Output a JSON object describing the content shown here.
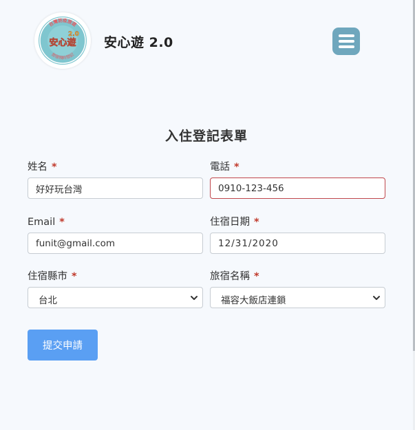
{
  "header": {
    "app_title": "安心遊 2.0",
    "logo_ring_text_top": "台灣防疫旅遊",
    "logo_center_text": "安心遊",
    "logo_ring_text_bottom": "旅宿預約登記",
    "logo_version": "2.0"
  },
  "form": {
    "title": "入住登記表單",
    "required_mark": "*",
    "fields": {
      "name": {
        "label": "姓名",
        "value": "好好玩台灣"
      },
      "phone": {
        "label": "電話",
        "value": "0910-123-456"
      },
      "email": {
        "label": "Email",
        "value": "funit@gmail.com"
      },
      "date": {
        "label": "住宿日期",
        "value": "12/31/2020"
      },
      "county": {
        "label": "住宿縣市",
        "selected": "台北"
      },
      "hotel": {
        "label": "旅宿名稱",
        "selected": "福容大飯店連鎖"
      }
    },
    "submit_label": "提交申請"
  },
  "colors": {
    "accent": "#5a9ff3",
    "menu": "#6fa7bd",
    "required": "#c0392b",
    "invalid_border": "#c0454a",
    "background": "#f6f9fd"
  },
  "icons": {
    "menu": "hamburger-icon",
    "select": "chevron-down-icon"
  }
}
